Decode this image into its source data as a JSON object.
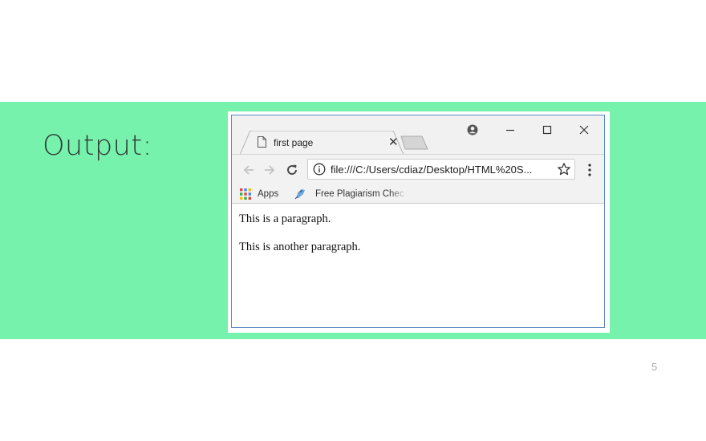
{
  "slide": {
    "heading": "Output:",
    "page_number": "5"
  },
  "browser": {
    "tab": {
      "title": "first page"
    },
    "address_bar": {
      "url": "file:///C:/Users/cdiaz/Desktop/HTML%20S..."
    },
    "bookmarks": [
      {
        "label": "Apps",
        "icon": "apps-grid-icon"
      },
      {
        "label": "Free Plagiarism Chec",
        "icon": "plagiarism-checker-icon"
      }
    ],
    "page": {
      "paragraphs": [
        "This is a paragraph.",
        "This is another paragraph."
      ]
    }
  },
  "colors": {
    "band": "#77f2ad",
    "window_border": "#5b89c4"
  }
}
